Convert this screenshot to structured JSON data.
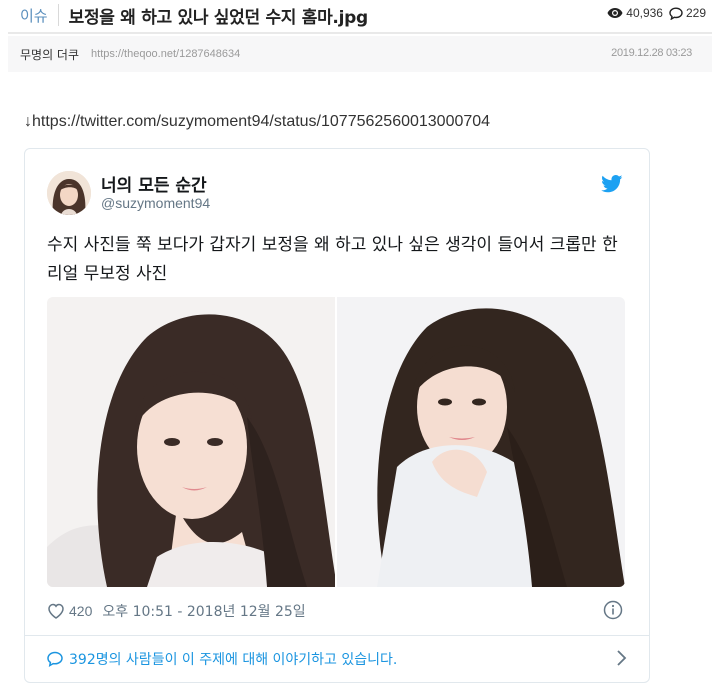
{
  "post": {
    "category": "이슈",
    "title": "보정을 왜 하고 있나 싶었던 수지 홈마.jpg",
    "views": "40,936",
    "comments": "229",
    "author": "무명의 더쿠",
    "url": "https://theqoo.net/1287648634",
    "date": "2019.12.28 03:23",
    "source_link": "↓https://twitter.com/suzymoment94/status/1077562560013000704"
  },
  "tweet": {
    "display_name": "너의 모든 순간",
    "handle": "@suzymoment94",
    "text": "수지 사진들 쭉 보다가 갑자기 보정을 왜 하고 있나 싶은 생각이 들어서 크롭만 한 리얼 무보정 사진",
    "likes": "420",
    "timestamp": "오후 10:51 - 2018년 12월 25일",
    "conversation": "392명의 사람들이 이 주제에 대해 이야기하고 있습니다."
  },
  "icons": {
    "views": "eye-icon",
    "comments": "comment-icon",
    "brand": "twitter-bird-icon",
    "like": "heart-icon",
    "info": "info-icon",
    "conversation": "speech-bubble-icon",
    "more": "chevron-right-icon"
  },
  "colors": {
    "category": "#5a8fbd",
    "twitter_blue": "#1da1f2",
    "link_blue": "#1b95e0",
    "meta_gray": "#657786"
  }
}
